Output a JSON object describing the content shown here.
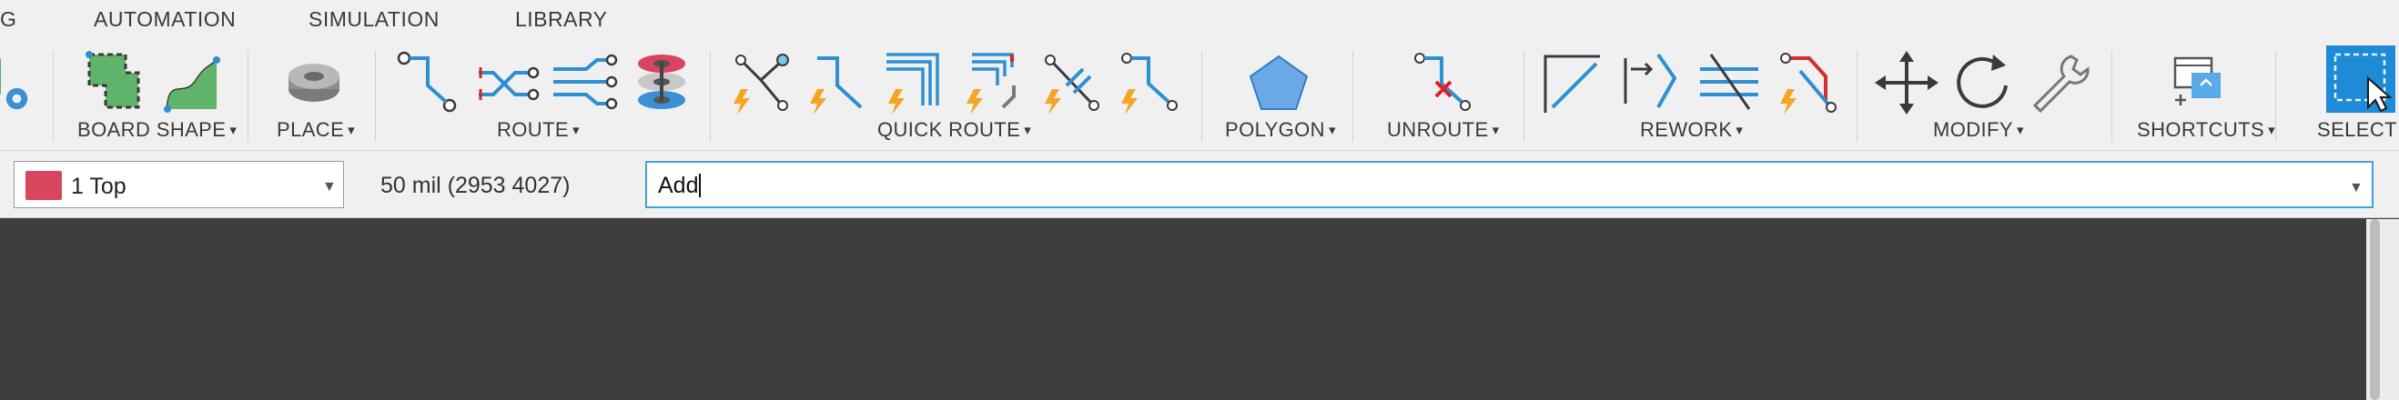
{
  "tabs": [
    "G",
    "AUTOMATION",
    "SIMULATION",
    "LIBRARY"
  ],
  "ribbon": {
    "groups": [
      {
        "label": "BOARD SHAPE",
        "dropdown": true
      },
      {
        "label": "PLACE",
        "dropdown": true
      },
      {
        "label": "ROUTE",
        "dropdown": true
      },
      {
        "label": "QUICK ROUTE",
        "dropdown": true
      },
      {
        "label": "POLYGON",
        "dropdown": true
      },
      {
        "label": "UNROUTE",
        "dropdown": true
      },
      {
        "label": "REWORK",
        "dropdown": true
      },
      {
        "label": "MODIFY",
        "dropdown": true
      },
      {
        "label": "SHORTCUTS",
        "dropdown": true
      },
      {
        "label": "SELECT",
        "dropdown": true
      }
    ],
    "caret": "▾"
  },
  "cmdbar": {
    "layer": {
      "label": "1 Top",
      "color": "#d9455f"
    },
    "grid_readout": "50 mil (2953 4027)",
    "command_value": "Add",
    "arrow": "▼"
  },
  "colors": {
    "accent": "#3fa2d6",
    "trace": "#2e8fd1",
    "bolt": "#f4a623",
    "polygon": "#6aa9e6",
    "unroute_x": "#e02020",
    "select_bg": "#1f8ad6"
  },
  "icons": [
    "board-outline-icon",
    "spline-icon",
    "component-icon",
    "route-icon",
    "diff-pair-icon",
    "multi-route-icon",
    "via-stack-icon",
    "fanout-icon",
    "quick-route-icon",
    "quick-bus-icon",
    "quick-multi-icon",
    "quick-diff-icon",
    "quick-airwire-icon",
    "polygon-icon",
    "unroute-icon",
    "line-icon",
    "slice-icon",
    "meander-icon",
    "ripup-icon",
    "move-icon",
    "rotate-icon",
    "wrench-icon",
    "shortcuts-icon",
    "select-icon"
  ]
}
